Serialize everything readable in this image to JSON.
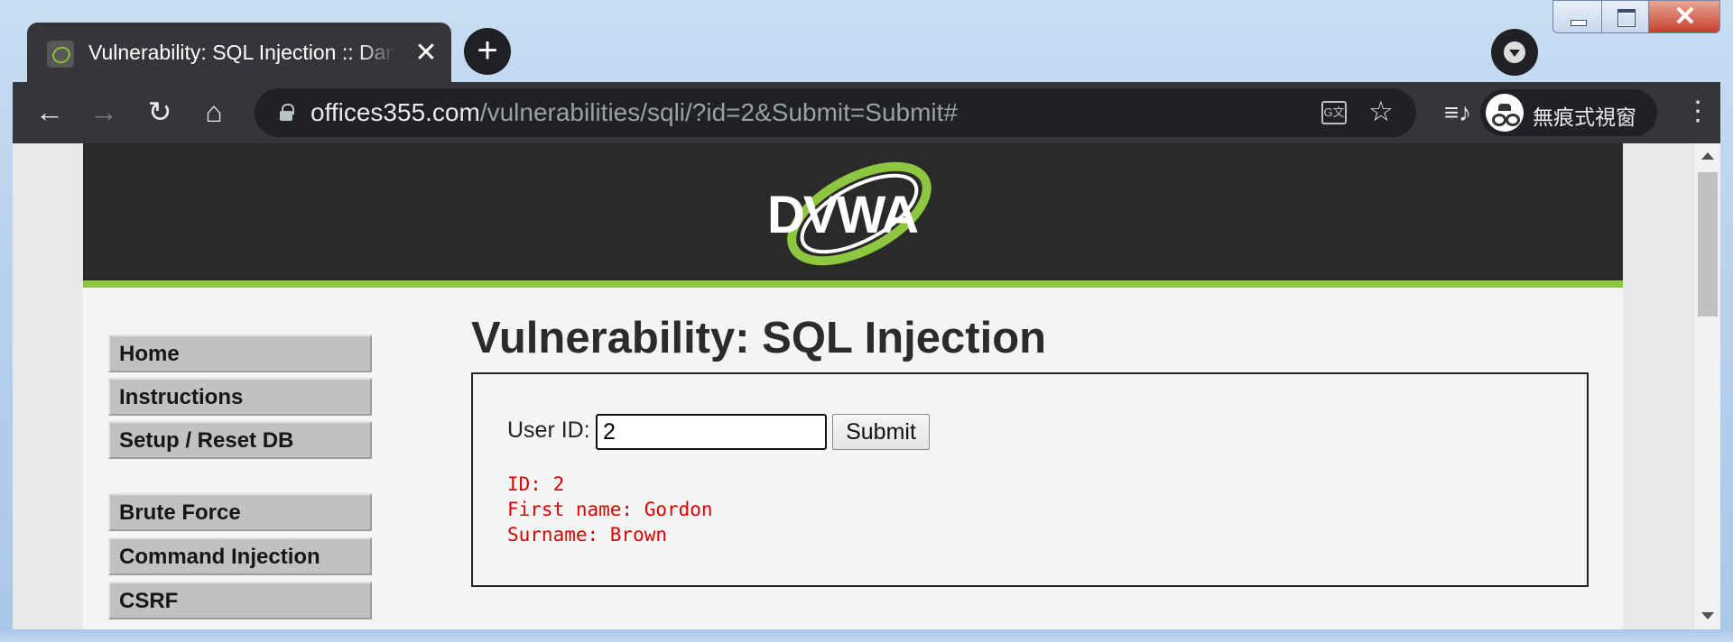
{
  "browser": {
    "tab_title": "Vulnerability: SQL Injection :: Damn Vulnerable Web Application (DVWA)",
    "tab_close": "✕",
    "new_tab": "+",
    "url_host": "offices355.com",
    "url_path": "/vulnerabilities/sqli/?id=2&Submit=Submit#",
    "incognito_label": "無痕式視窗",
    "icons": {
      "back": "←",
      "forward": "→",
      "reload": "↻",
      "home": "⌂",
      "star": "☆",
      "media": "≡♪",
      "menu": "⋮",
      "close_window": "✕",
      "translate": "G文"
    }
  },
  "page": {
    "logo_text": "DVWA",
    "title": "Vulnerability: SQL Injection",
    "sidebar": {
      "items": [
        {
          "label": "Home"
        },
        {
          "label": "Instructions"
        },
        {
          "label": "Setup / Reset DB"
        },
        {
          "label": "Brute Force"
        },
        {
          "label": "Command Injection"
        },
        {
          "label": "CSRF"
        }
      ]
    },
    "form": {
      "user_id_label": "User ID:",
      "user_id_value": "2",
      "submit_label": "Submit"
    },
    "result": {
      "id_line": "ID: 2",
      "first_name_line": "First name: Gordon",
      "surname_line": "Surname: Brown"
    }
  },
  "colors": {
    "accent_green": "#8dc63f",
    "header_bg": "#2a2a2a",
    "result_red": "#e00000"
  }
}
